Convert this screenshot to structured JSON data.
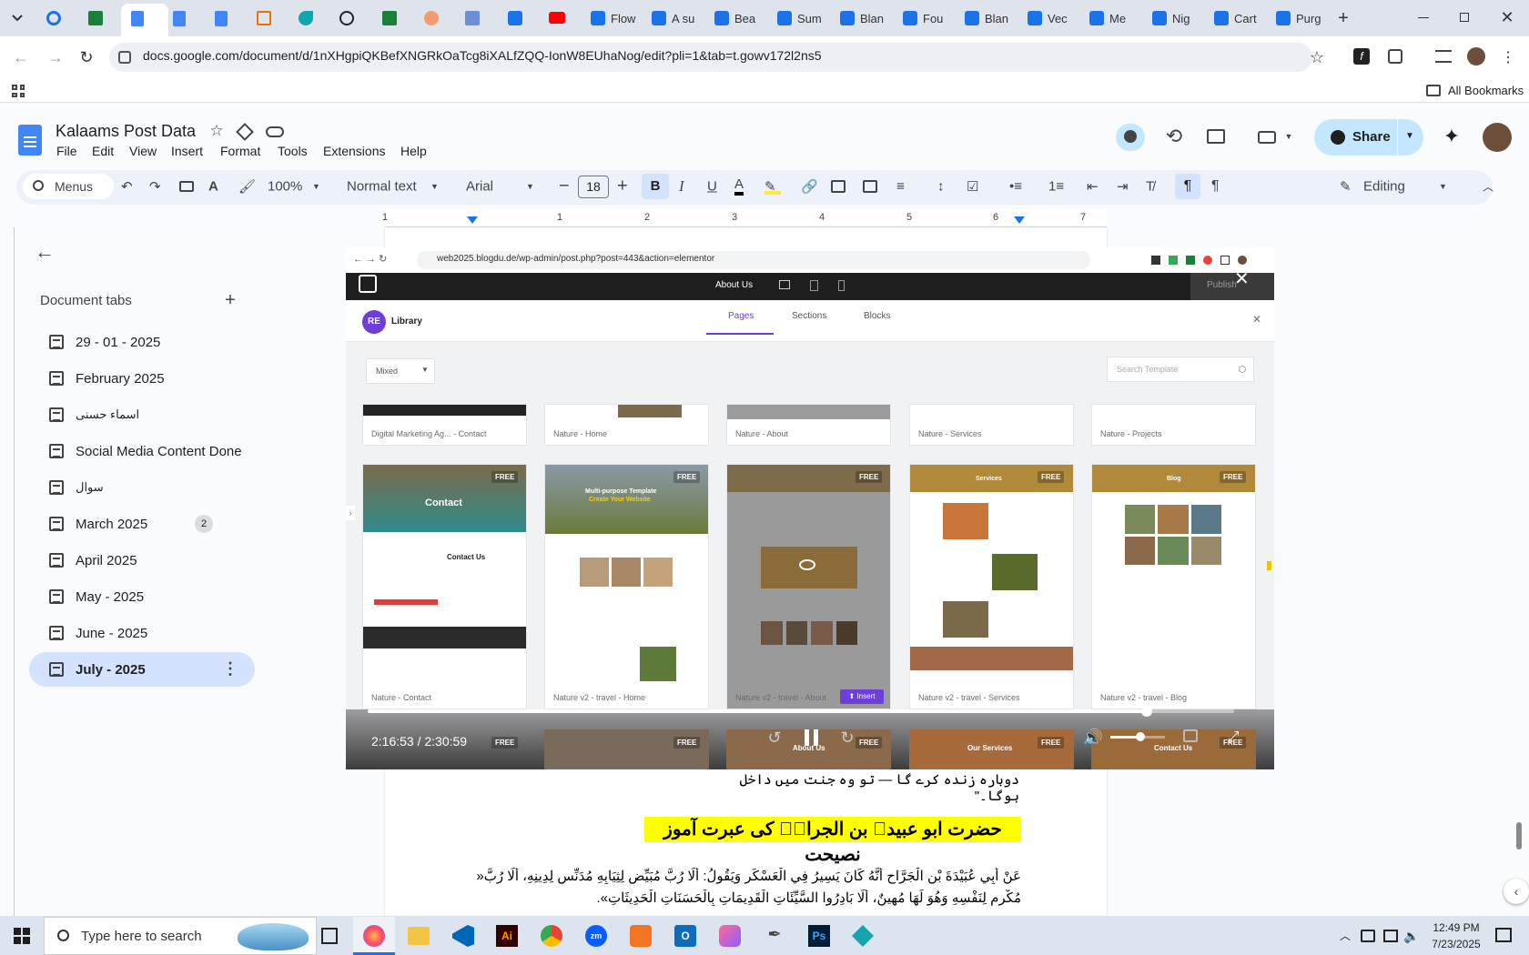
{
  "browser": {
    "tabs": [
      "Flow",
      "A su",
      "Bea",
      "Sum",
      "Blan",
      "Fou",
      "Blan",
      "Vec",
      "Me",
      "Nig",
      "Cart",
      "Purg"
    ],
    "url": "docs.google.com/document/d/1nXHgpiQKBefXNGRkOaTcg8iXALfZQQ-IonW8EUhaNog/edit?pli=1&tab=t.gowv172l2ns5",
    "all_bookmarks": "All Bookmarks"
  },
  "docs": {
    "title": "Kalaams Post Data",
    "menus": [
      "File",
      "Edit",
      "View",
      "Insert",
      "Format",
      "Tools",
      "Extensions",
      "Help"
    ],
    "share_label": "Share",
    "toolbar": {
      "menus_search": "Menus",
      "zoom": "100%",
      "style": "Normal text",
      "font": "Arial",
      "font_size": "18",
      "editing": "Editing"
    },
    "ruler_numbers": [
      "1",
      "1",
      "2",
      "3",
      "4",
      "5",
      "6",
      "7"
    ]
  },
  "sidebar": {
    "heading": "Document tabs",
    "tabs": [
      {
        "label": "29 - 01 - 2025",
        "badge": ""
      },
      {
        "label": "February 2025",
        "badge": ""
      },
      {
        "label": "اسماء حسنی",
        "badge": ""
      },
      {
        "label": "Social Media Content Done",
        "badge": ""
      },
      {
        "label": "سوال",
        "badge": ""
      },
      {
        "label": "March 2025",
        "badge": "2"
      },
      {
        "label": "April 2025",
        "badge": ""
      },
      {
        "label": "May - 2025",
        "badge": ""
      },
      {
        "label": "June - 2025",
        "badge": ""
      },
      {
        "label": "July - 2025",
        "badge": ""
      }
    ],
    "selected_index": 9
  },
  "video": {
    "inner_url": "web2025.blogdu.de/wp-admin/post.php?post=443&action=elementor",
    "editor_page": "About Us",
    "publish": "Publish",
    "library_title": "Library",
    "library_tabs": [
      "Pages",
      "Sections",
      "Blocks"
    ],
    "filter": "Mixed",
    "search_placeholder": "Search Template",
    "row1": [
      "Digital Marketing Ag... - Contact",
      "Nature - Home",
      "Nature - About",
      "Nature - Services",
      "Nature - Projects"
    ],
    "row2": [
      "Nature - Contact",
      "Nature v2 - travel - Home",
      "Nature v2 - travel - About",
      "Nature v2 - travel - Services",
      "Nature v2 - travel - Blog"
    ],
    "thumb_titles": [
      "Contact",
      "Multi-purpose Template",
      "",
      "Services",
      "Blog"
    ],
    "thumb_sub": [
      "Contact Us",
      "Create Your Website",
      "",
      "",
      ""
    ],
    "free": "FREE",
    "insert": "Insert",
    "row3": [
      "",
      "About Us",
      "",
      "Our Services",
      "Contact Us"
    ],
    "time": "2:16:53 / 2:30:59",
    "progress": 0.899,
    "volume": 0.55
  },
  "doc_content": {
    "line1": "دوبارہ زندہ کرے گا — تو وہ جنت میں داخل ہوگا۔\"",
    "heading": "حضرت ابو عبیدہ بن الجراحؓ کی عبرت آموز نصیحت",
    "arabic1": "عَنْ أَبِي عُبَيْدَةَ بْنِ الْجَرَّاحِ أَنَّهُ كَانَ يَسِيرُ فِي الْعَسْكَرِ وَيَقُولُ: أَلَا رُبَّ مُبَيِّضٍ لِثِيَابِهِ مُدَنِّسٍ لِدِينِهِ، أَلَا رُبَّ«",
    "arabic2": "مُكْرِمٍ لِنَفْسِهِ وَهُوَ لَهَا مُهِينٌ، أَلَا بَادِرُوا السَّيِّئَاتِ الْقَدِيمَاتِ بِالْحَسَنَاتِ الْحَدِيثَاتِ».",
    "highlight_color": "#ffff00"
  },
  "taskbar": {
    "search_placeholder": "Type here to search",
    "time": "12:49 PM",
    "date": "7/23/2025"
  },
  "colors": {
    "accent": "#0b57d0",
    "share_bg": "#c2e7ff",
    "selected_tab": "#d3e3fd",
    "elementor": "#6d3fd8"
  }
}
